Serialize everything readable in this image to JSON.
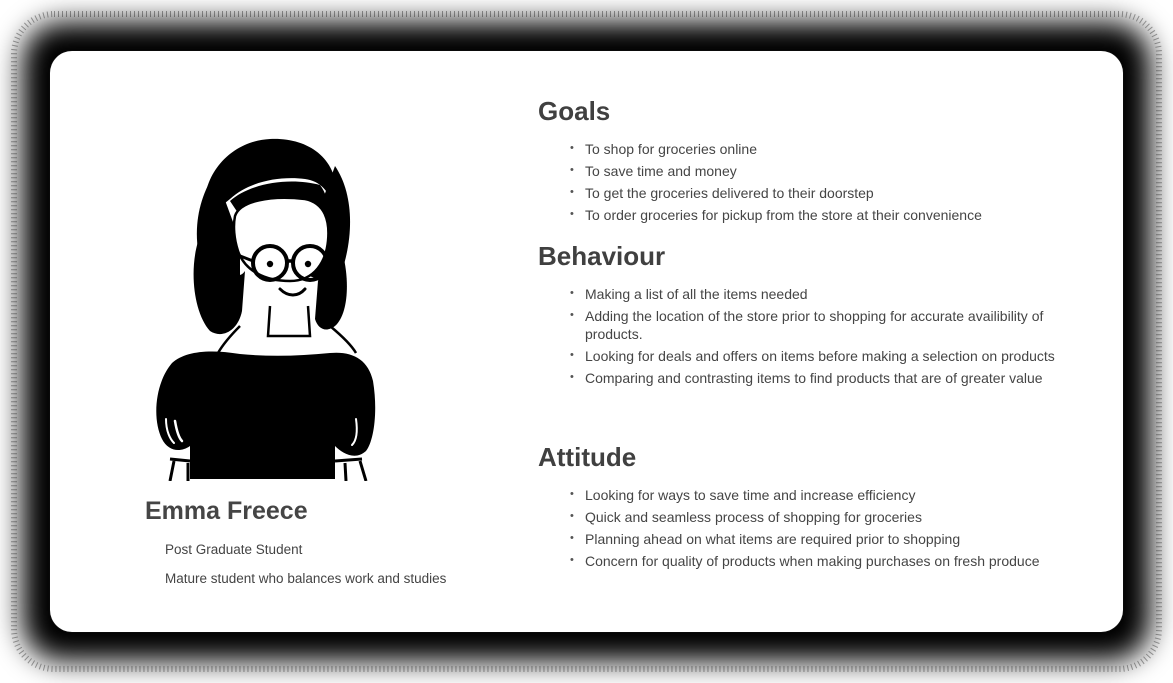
{
  "persona": {
    "name": "Emma Freece",
    "role": "Post Graduate Student",
    "description": "Mature student who balances work and studies",
    "illustration_icon": "woman-with-glasses-illustration"
  },
  "sections": {
    "goals": {
      "title": "Goals",
      "items": [
        "To shop for groceries online",
        "To save time and money",
        "To get the groceries delivered to their doorstep",
        "To order groceries for pickup from the store at their convenience"
      ]
    },
    "behaviour": {
      "title": "Behaviour",
      "items": [
        "Making a list of all the items needed",
        "Adding the location of the store prior to shopping for accurate availibility of products.",
        "Looking for deals and offers on items before making a selection on products",
        "Comparing and contrasting items to find products that are of greater value"
      ]
    },
    "attitude": {
      "title": "Attitude",
      "items": [
        "Looking for ways to save time and increase efficiency",
        "Quick and seamless process of shopping for groceries",
        "Planning ahead on what items are required prior to shopping",
        "Concern for quality of products when making purchases on fresh produce"
      ]
    }
  },
  "colors": {
    "frame": "#000000",
    "card": "#ffffff",
    "text": "#454545"
  }
}
